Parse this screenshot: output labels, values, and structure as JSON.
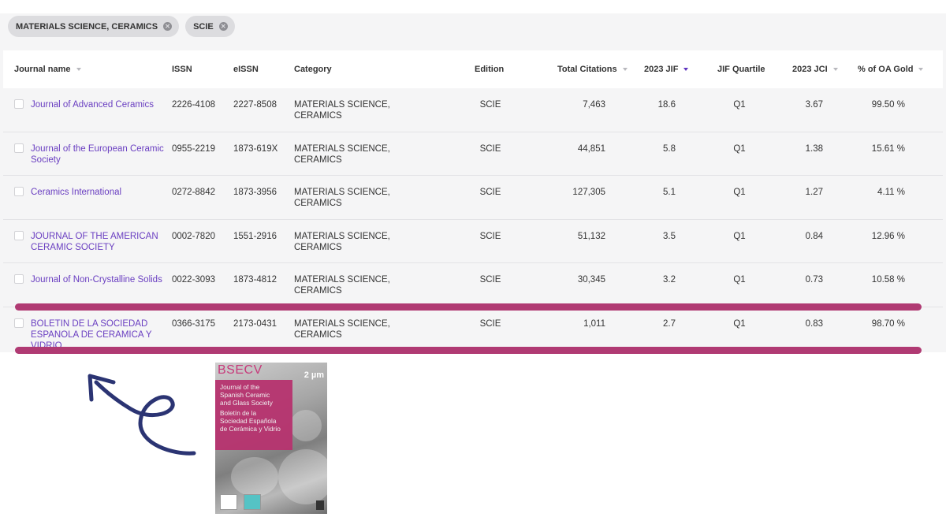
{
  "filters": [
    {
      "label": "MATERIALS SCIENCE, CERAMICS",
      "remove_icon": "close-circle-icon"
    },
    {
      "label": "SCIE",
      "remove_icon": "close-circle-icon"
    }
  ],
  "columns": {
    "journal_name": "Journal name",
    "issn": "ISSN",
    "eissn": "eISSN",
    "category": "Category",
    "edition": "Edition",
    "total_citations": "Total Citations",
    "jif": "2023 JIF",
    "jif_quartile": "JIF Quartile",
    "jci": "2023 JCI",
    "oa_gold": "% of OA Gold"
  },
  "sorted_by": "2023 JIF",
  "rows": [
    {
      "journal": "Journal of Advanced Ceramics",
      "issn": "2226-4108",
      "eissn": "2227-8508",
      "category": "MATERIALS SCIENCE,\nCERAMICS",
      "edition": "SCIE",
      "citations": "7,463",
      "jif": "18.6",
      "quartile": "Q1",
      "jci": "3.67",
      "oa": "99.50 %"
    },
    {
      "journal": "Journal of the European Ceramic Society",
      "issn": "0955-2219",
      "eissn": "1873-619X",
      "category": "MATERIALS SCIENCE,\nCERAMICS",
      "edition": "SCIE",
      "citations": "44,851",
      "jif": "5.8",
      "quartile": "Q1",
      "jci": "1.38",
      "oa": "15.61 %"
    },
    {
      "journal": "Ceramics International",
      "issn": "0272-8842",
      "eissn": "1873-3956",
      "category": "MATERIALS SCIENCE,\nCERAMICS",
      "edition": "SCIE",
      "citations": "127,305",
      "jif": "5.1",
      "quartile": "Q1",
      "jci": "1.27",
      "oa": "4.11 %"
    },
    {
      "journal": "JOURNAL OF THE AMERICAN CERAMIC SOCIETY",
      "issn": "0002-7820",
      "eissn": "1551-2916",
      "category": "MATERIALS SCIENCE,\nCERAMICS",
      "edition": "SCIE",
      "citations": "51,132",
      "jif": "3.5",
      "quartile": "Q1",
      "jci": "0.84",
      "oa": "12.96 %"
    },
    {
      "journal": "Journal of Non-Crystalline Solids",
      "issn": "0022-3093",
      "eissn": "1873-4812",
      "category": "MATERIALS SCIENCE,\nCERAMICS",
      "edition": "SCIE",
      "citations": "30,345",
      "jif": "3.2",
      "quartile": "Q1",
      "jci": "0.73",
      "oa": "10.58 %"
    },
    {
      "journal": "BOLETIN DE LA SOCIEDAD ESPANOLA DE CERAMICA Y VIDRIO",
      "issn": "0366-3175",
      "eissn": "2173-0431",
      "category": "MATERIALS SCIENCE,\nCERAMICS",
      "edition": "SCIE",
      "citations": "1,011",
      "jif": "2.7",
      "quartile": "Q1",
      "jci": "0.83",
      "oa": "98.70 %"
    }
  ],
  "highlight_color": "#b03a73",
  "link_color": "#6a3fc1",
  "arrow_color": "#2b3473",
  "cover": {
    "title": "BSECV",
    "scale": "2 µm",
    "en_line1": "Journal of the",
    "en_line2": "Spanish Ceramic",
    "en_line3": "and Glass Society",
    "es_line1": "Boletín de la",
    "es_line2": "Sociedad Española",
    "es_line3": "de Cerámica y Vidrio"
  }
}
